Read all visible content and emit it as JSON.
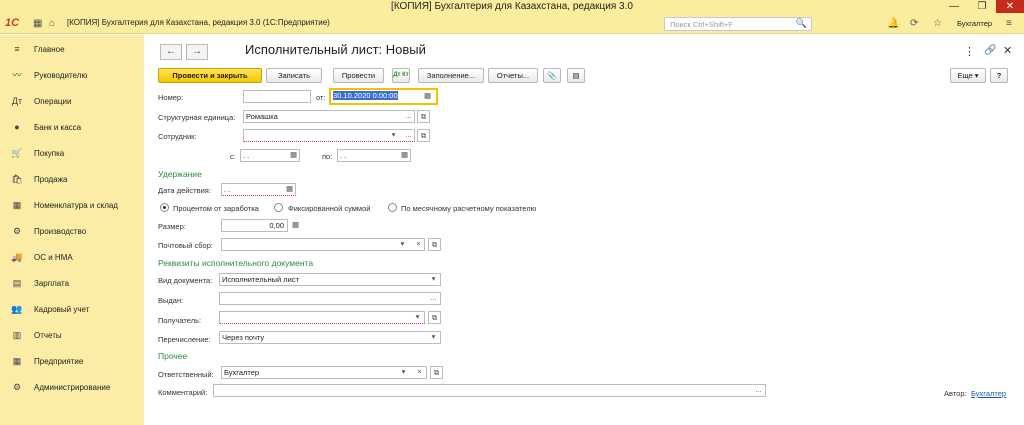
{
  "window": {
    "title": "[КОПИЯ] Бухгалтерия для Казахстана, редакция 3.0",
    "minimize": "—",
    "maximize": "❐",
    "close": "✕"
  },
  "header": {
    "logo": "1С",
    "app_title": "[КОПИЯ] Бухгалтерия для Казахстана, редакция 3.0  (1С:Предприятие)",
    "search_placeholder": "Поиск Ctrl+Shift+F",
    "user": "Бухгалтер",
    "icons": {
      "grid": "▦",
      "home": "⌂",
      "notifications": "🔔",
      "history": "⟳",
      "favorites": "☆",
      "search": "🔍",
      "menu": "≡"
    }
  },
  "sidebar": {
    "items": [
      {
        "label": "Главное",
        "icon": "≡"
      },
      {
        "label": "Руководителю",
        "icon": "〰"
      },
      {
        "label": "Операции",
        "icon": "Дт"
      },
      {
        "label": "Банк и касса",
        "icon": "●"
      },
      {
        "label": "Покупка",
        "icon": "🛒"
      },
      {
        "label": "Продажа",
        "icon": "🛍"
      },
      {
        "label": "Номенклатура и склад",
        "icon": "▦"
      },
      {
        "label": "Производство",
        "icon": "⚙"
      },
      {
        "label": "ОС и НМА",
        "icon": "🚚"
      },
      {
        "label": "Зарплата",
        "icon": "▤"
      },
      {
        "label": "Кадровый учет",
        "icon": "👥"
      },
      {
        "label": "Отчеты",
        "icon": "▥"
      },
      {
        "label": "Предприятие",
        "icon": "▦"
      },
      {
        "label": "Администрирование",
        "icon": "⚙"
      }
    ]
  },
  "form": {
    "title": "Исполнительный лист: Новый",
    "nav": {
      "back": "←",
      "forward": "→"
    },
    "top_icons": {
      "more": "⋮",
      "link": "🔗",
      "close": "✕"
    },
    "toolbar": {
      "post_close": "Провести и закрыть",
      "save": "Записать",
      "post": "Провести",
      "dtkt": "Дт Кт",
      "fill": "Заполнение...",
      "reports": "Отчеты...",
      "attach": "📎",
      "structure": "▤",
      "more": "Еще ▾",
      "help": "?"
    },
    "number_label": "Номер:",
    "number_value": "",
    "date_label": "от:",
    "date_value": "30.10.2020  0:00:00",
    "unit_label": "Структурная единица:",
    "unit_value": "Ромашка",
    "employee_label": "Сотрудник:",
    "employee_value": "",
    "from_label": "с:",
    "from_value": " .  .",
    "to_label": "по:",
    "to_value": " .  .",
    "section_deduction": "Удержание",
    "action_date_label": "Дата действия:",
    "action_date_value": " .  .",
    "radio": {
      "percent": "Процентом от заработка",
      "fixed": "Фиксированной суммой",
      "monthly": "По месячному расчетному показателю"
    },
    "size_label": "Размер:",
    "size_value": "0,00",
    "postal_label": "Почтовый сбор:",
    "postal_value": "",
    "section_requisites": "Реквизиты исполнительного документа",
    "doc_type_label": "Вид документа:",
    "doc_type_value": "Исполнительный лист",
    "issued_label": "Выдан:",
    "issued_value": "",
    "recipient_label": "Получатель:",
    "recipient_value": "",
    "transfer_label": "Перечисление:",
    "transfer_value": "Через почту",
    "section_other": "Прочее",
    "responsible_label": "Ответственный:",
    "responsible_value": "Бухгалтер",
    "comment_label": "Комментарий:",
    "comment_value": "",
    "author_label": "Автор:",
    "author_value": "Бухгалтер",
    "btn_select": "...",
    "btn_open": "⧉",
    "btn_dropdown": "▾",
    "btn_clear": "×",
    "btn_calendar": "▦",
    "btn_calc": "▦"
  }
}
